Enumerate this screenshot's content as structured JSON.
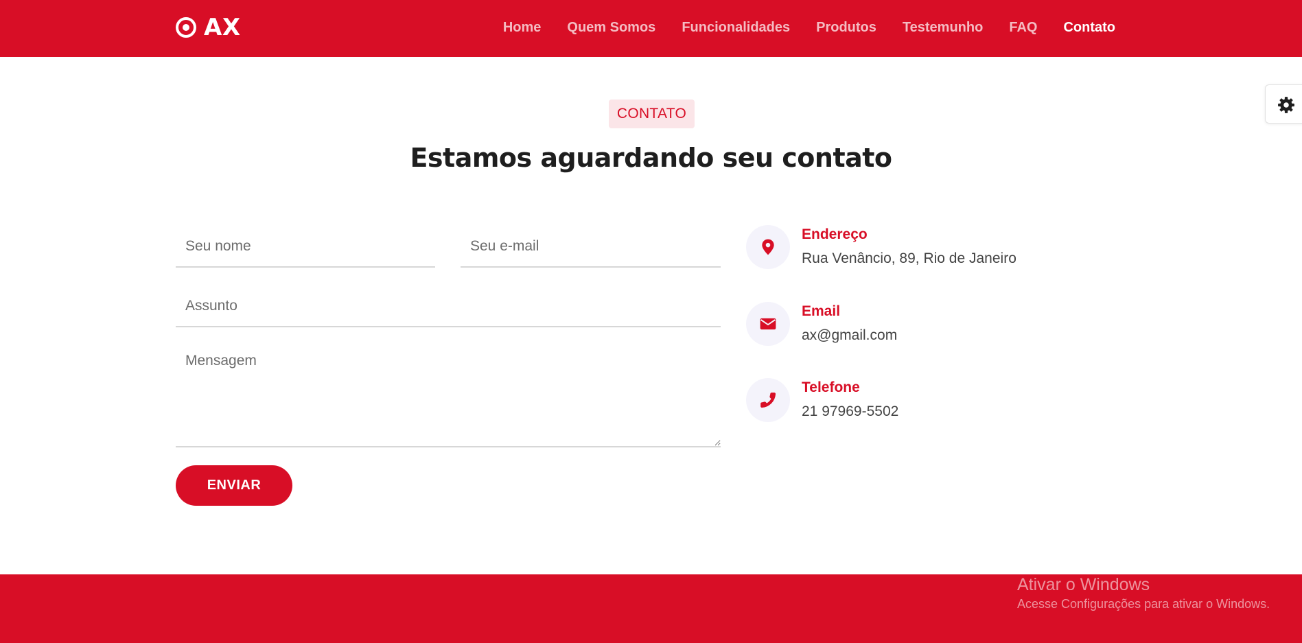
{
  "header": {
    "logo_text": "AX",
    "logo_icon": "target-icon",
    "nav": [
      {
        "label": "Home"
      },
      {
        "label": "Quem Somos"
      },
      {
        "label": "Funcionalidades"
      },
      {
        "label": "Produtos"
      },
      {
        "label": "Testemunho"
      },
      {
        "label": "FAQ"
      },
      {
        "label": "Contato",
        "active": true
      }
    ]
  },
  "settings": {
    "icon": "gear-icon"
  },
  "section": {
    "badge": "CONTATO",
    "title": "Estamos aguardando seu contato"
  },
  "form": {
    "name_placeholder": "Seu nome",
    "email_placeholder": "Seu e-mail",
    "subject_placeholder": "Assunto",
    "message_placeholder": "Mensagem",
    "submit_label": "ENVIAR"
  },
  "contact_info": [
    {
      "icon": "map-pin-icon",
      "title": "Endereço",
      "text": "Rua Venâncio, 89, Rio de Janeiro"
    },
    {
      "icon": "envelope-icon",
      "title": "Email",
      "text": "ax@gmail.com"
    },
    {
      "icon": "phone-icon",
      "title": "Telefone",
      "text": "21 97969-5502"
    }
  ],
  "watermark": {
    "title": "Ativar o Windows",
    "subtitle": "Acesse Configurações para ativar o Windows."
  },
  "colors": {
    "brand_red": "#d80e26",
    "badge_bg": "#fbe5e8",
    "icon_circle_bg": "#f4f3fb"
  }
}
